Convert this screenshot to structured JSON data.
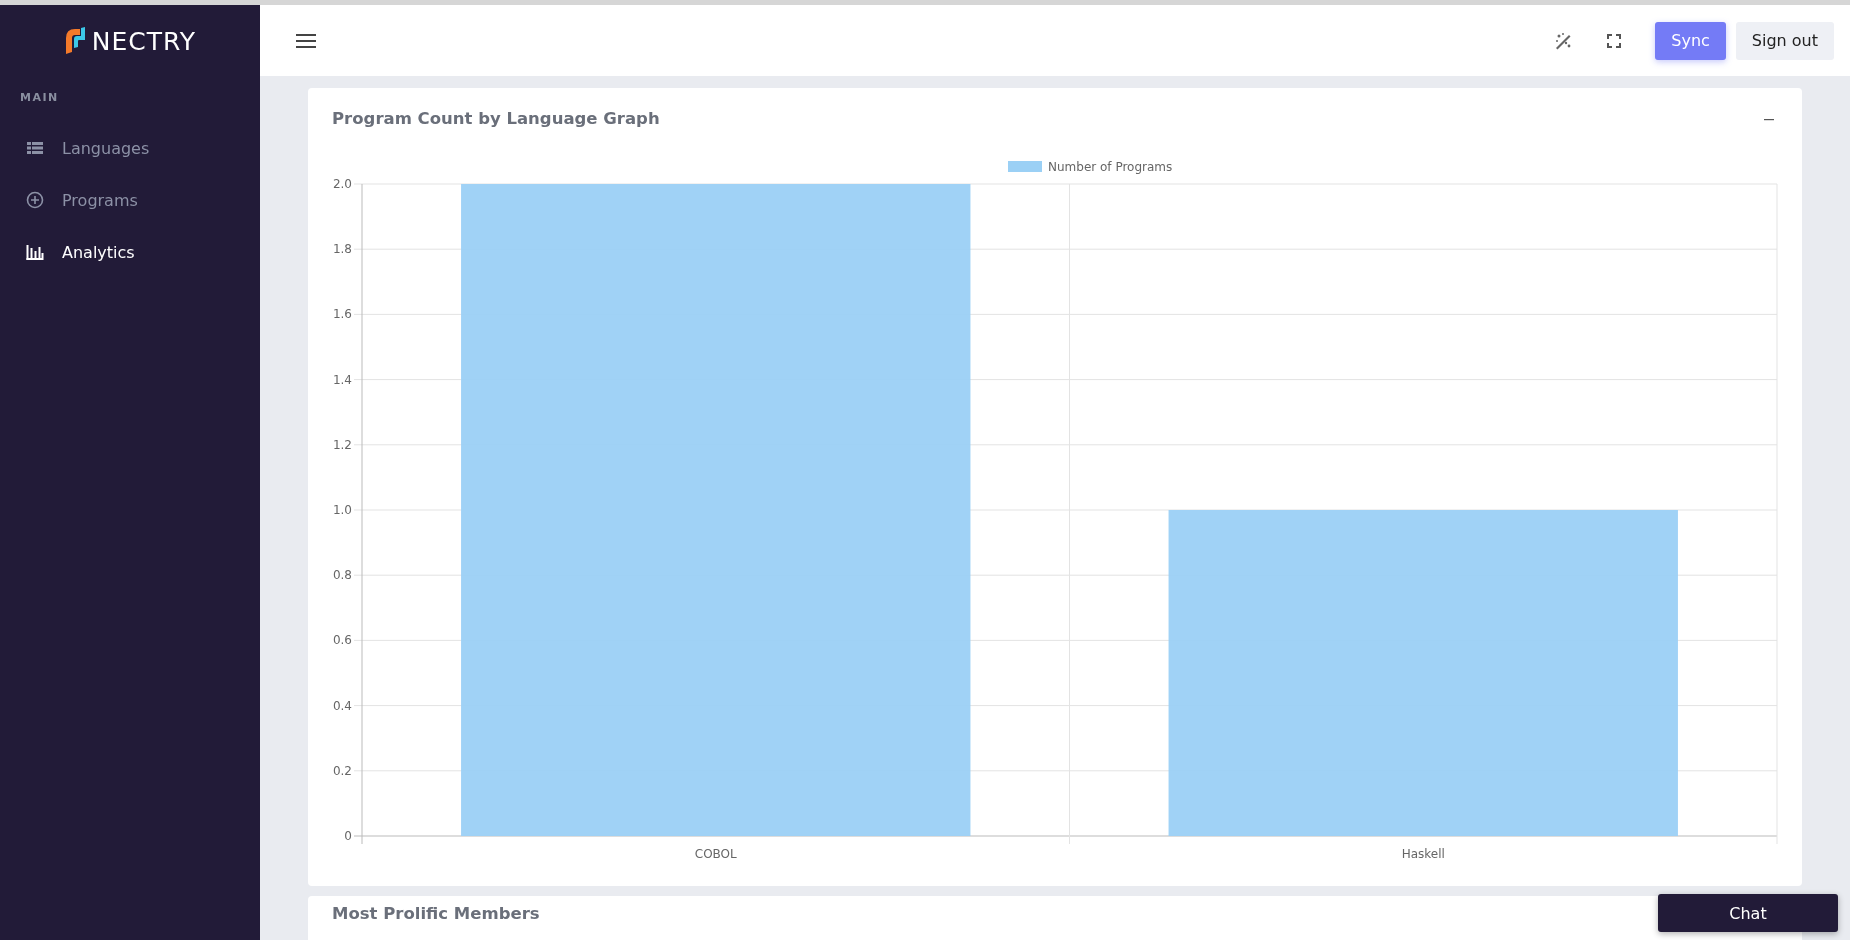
{
  "sidebar": {
    "brand": "NECTRY",
    "section_label": "MAIN",
    "items": [
      {
        "label": "Languages",
        "selected": false
      },
      {
        "label": "Programs",
        "selected": false
      },
      {
        "label": "Analytics",
        "selected": true
      }
    ]
  },
  "topbar": {
    "buttons": [
      {
        "label": "Sync",
        "kind": "primary"
      },
      {
        "label": "Sign out",
        "kind": "secondary"
      }
    ]
  },
  "panels": [
    {
      "title": "Program Count by Language Graph",
      "collapse_symbol": "–",
      "chart_data": {
        "type": "bar",
        "grid": true,
        "categories": [
          "COBOL",
          "Haskell"
        ],
        "series": [
          {
            "name": "Number of Programs",
            "color": "#9bd0f5",
            "values": [
              2,
              1
            ]
          }
        ],
        "ylim": [
          0,
          2
        ],
        "yticks": [
          0,
          {
            "value": 0.2,
            "label": "0.2"
          },
          {
            "value": 0.4,
            "label": "0.4"
          },
          {
            "value": 0.6,
            "label": "0.6"
          },
          {
            "value": 0.8,
            "label": "0.8"
          },
          {
            "value": 1,
            "label": "1.0"
          },
          {
            "value": 1.2,
            "label": "1.2"
          },
          {
            "value": 1.4,
            "label": "1.4"
          },
          {
            "value": 1.6,
            "label": "1.6"
          },
          {
            "value": 1.8,
            "label": "1.8"
          },
          {
            "value": 2,
            "label": "2.0"
          }
        ]
      }
    },
    {
      "title": "Most Prolific Members"
    }
  ],
  "chat_button": {
    "label": "Chat"
  }
}
